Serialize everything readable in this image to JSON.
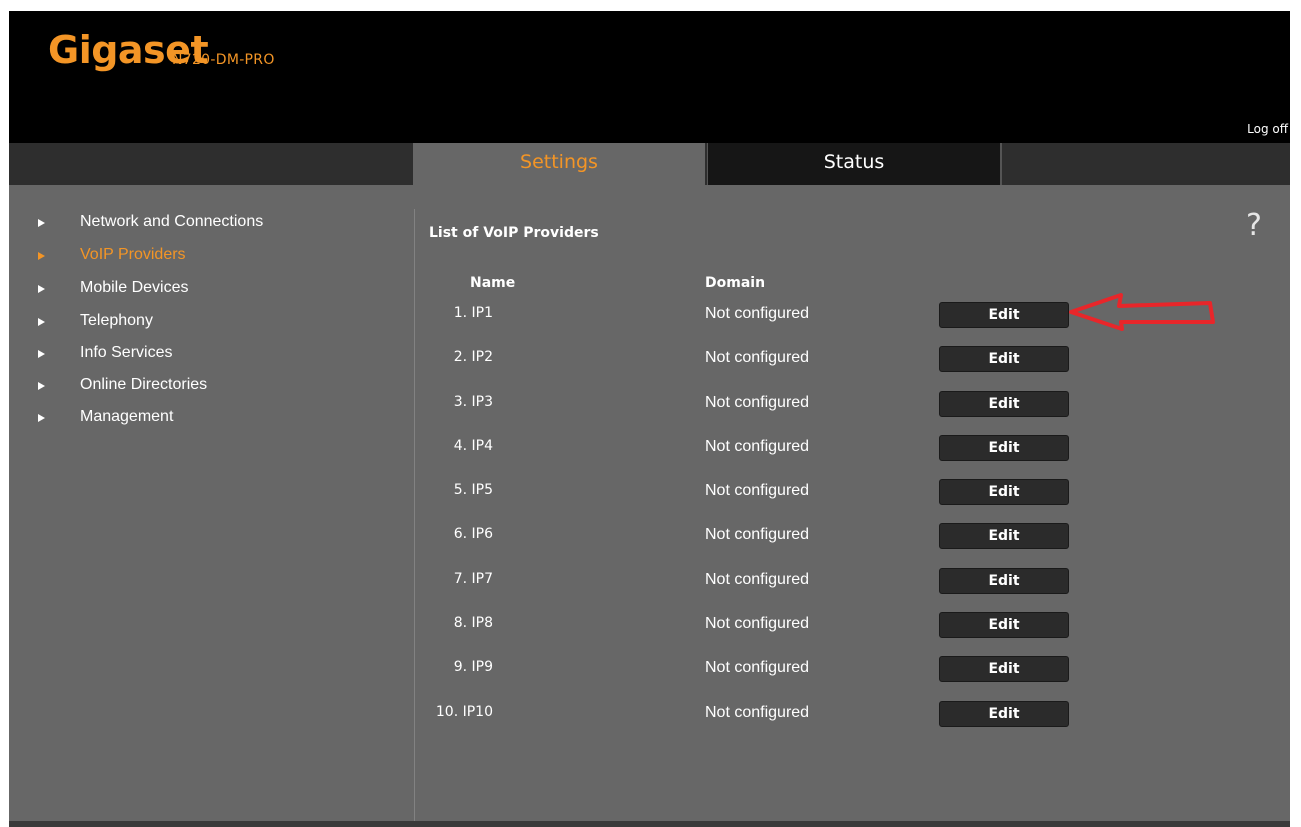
{
  "header": {
    "brand": "Gigaset",
    "model": "N720-DM-PRO",
    "logoff": "Log off"
  },
  "tabs": [
    {
      "label": "Settings",
      "active": true
    },
    {
      "label": "Status",
      "active": false
    }
  ],
  "sidebar": {
    "items": [
      {
        "label": "Network and Connections",
        "active": false
      },
      {
        "label": "VoIP Providers",
        "active": true
      },
      {
        "label": "Mobile Devices",
        "active": false
      },
      {
        "label": "Telephony",
        "active": false
      },
      {
        "label": "Info Services",
        "active": false
      },
      {
        "label": "Online Directories",
        "active": false
      },
      {
        "label": "Management",
        "active": false
      }
    ]
  },
  "main": {
    "title": "List of VoIP Providers",
    "help": "?",
    "columns": {
      "name": "Name",
      "domain": "Domain"
    },
    "rows": [
      {
        "name": "1. IP1",
        "domain": "Not configured",
        "action": "Edit"
      },
      {
        "name": "2. IP2",
        "domain": "Not configured",
        "action": "Edit"
      },
      {
        "name": "3. IP3",
        "domain": "Not configured",
        "action": "Edit"
      },
      {
        "name": "4. IP4",
        "domain": "Not configured",
        "action": "Edit"
      },
      {
        "name": "5. IP5",
        "domain": "Not configured",
        "action": "Edit"
      },
      {
        "name": "6. IP6",
        "domain": "Not configured",
        "action": "Edit"
      },
      {
        "name": "7. IP7",
        "domain": "Not configured",
        "action": "Edit"
      },
      {
        "name": "8. IP8",
        "domain": "Not configured",
        "action": "Edit"
      },
      {
        "name": "9. IP9",
        "domain": "Not configured",
        "action": "Edit"
      },
      {
        "name": "10. IP10",
        "domain": "Not configured",
        "action": "Edit"
      }
    ]
  },
  "colors": {
    "accent": "#f39526",
    "background": "#676767",
    "header": "#000000",
    "annotation_arrow": "#e8262a"
  },
  "annotation": {
    "icon": "red-arrow-icon"
  }
}
